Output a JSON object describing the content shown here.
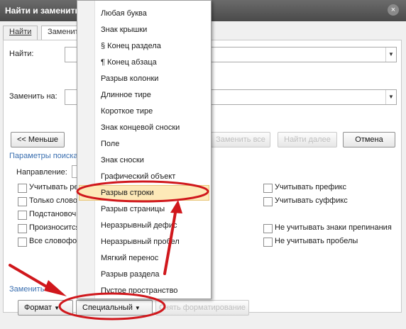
{
  "window": {
    "title": "Найти и заменить",
    "close_glyph": "×"
  },
  "tabs": [
    {
      "label": "Найти"
    },
    {
      "label": "Заменить"
    }
  ],
  "find": {
    "label": "Найти:"
  },
  "replace": {
    "label": "Заменить на:"
  },
  "buttons": {
    "less": "<< Меньше",
    "replace_all": "Заменить все",
    "find_next": "Найти далее",
    "cancel": "Отмена",
    "format": "Формат",
    "special": "Специальный",
    "no_formatting": "Снять форматирование"
  },
  "search_params": {
    "heading": "Параметры поиска",
    "direction_label": "Направление:"
  },
  "checkboxes_left": [
    "Учитывать регистр",
    "Только слово целиком",
    "Подстановочные знаки",
    "Произносится как",
    "Все словоформы"
  ],
  "checkboxes_right": [
    "Учитывать префикс",
    "Учитывать суффикс",
    "Не учитывать знаки препинания",
    "Не учитывать пробелы"
  ],
  "replace_section": {
    "heading": "Заменить"
  },
  "menu": {
    "items": [
      "Любая буква",
      "Знак крышки",
      "§ Конец раздела",
      "¶ Конец абзаца",
      "Разрыв колонки",
      "Длинное тире",
      "Короткое тире",
      "Знак концевой сноски",
      "Поле",
      "Знак сноски",
      "Графический объект",
      "Разрыв строки",
      "Разрыв страницы",
      "Неразрывный дефис",
      "Неразрывный пробел",
      "Мягкий перенос",
      "Разрыв раздела",
      "Пустое пространство"
    ],
    "highlighted": "Разрыв строки"
  },
  "colors": {
    "annotation_red": "#d0171c",
    "highlight": "#fde9b8",
    "link_blue": "#3a6fb0"
  }
}
